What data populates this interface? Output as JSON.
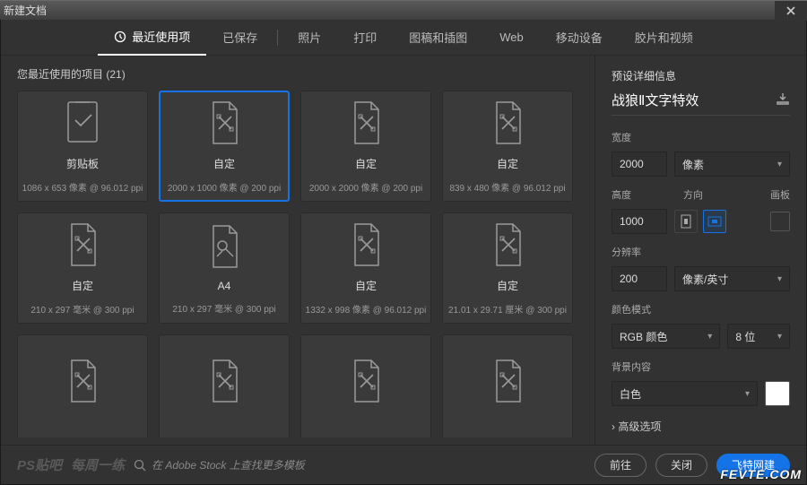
{
  "title": "新建文档",
  "tabs": [
    {
      "label": "最近使用项",
      "active": true
    },
    {
      "label": "已保存"
    },
    {
      "label": "照片"
    },
    {
      "label": "打印"
    },
    {
      "label": "图稿和插图"
    },
    {
      "label": "Web"
    },
    {
      "label": "移动设备"
    },
    {
      "label": "胶片和视频"
    }
  ],
  "recent_header_prefix": "您最近使用的项目",
  "recent_count": "(21)",
  "presets": [
    {
      "name": "剪贴板",
      "spec": "1086 x 653 像素 @ 96.012 ppi",
      "icon": "clipboard"
    },
    {
      "name": "自定",
      "spec": "2000 x 1000 像素 @ 200 ppi",
      "icon": "custom",
      "selected": true
    },
    {
      "name": "自定",
      "spec": "2000 x 2000 像素 @ 200 ppi",
      "icon": "custom"
    },
    {
      "name": "自定",
      "spec": "839 x 480 像素 @ 96.012 ppi",
      "icon": "custom"
    },
    {
      "name": "自定",
      "spec": "210 x 297 毫米 @ 300 ppi",
      "icon": "custom"
    },
    {
      "name": "A4",
      "spec": "210 x 297 毫米 @ 300 ppi",
      "icon": "a4"
    },
    {
      "name": "自定",
      "spec": "1332 x 998 像素 @ 96.012 ppi",
      "icon": "custom"
    },
    {
      "name": "自定",
      "spec": "21.01 x 29.71 厘米 @ 300 ppi",
      "icon": "custom"
    },
    {
      "name": "",
      "spec": "",
      "icon": "custom"
    },
    {
      "name": "",
      "spec": "",
      "icon": "custom"
    },
    {
      "name": "",
      "spec": "",
      "icon": "custom"
    },
    {
      "name": "",
      "spec": "",
      "icon": "custom"
    }
  ],
  "detail": {
    "section": "预设详细信息",
    "preset_name": "战狼Ⅱ文字特效",
    "width_label": "宽度",
    "width_value": "2000",
    "width_unit": "像素",
    "height_label": "高度",
    "height_value": "1000",
    "orient_label": "方向",
    "artboard_label": "画板",
    "resolution_label": "分辨率",
    "resolution_value": "200",
    "resolution_unit": "像素/英寸",
    "colormode_label": "颜色模式",
    "colormode_value": "RGB 颜色",
    "bitdepth": "8 位",
    "bg_label": "背景内容",
    "bg_value": "白色",
    "bg_swatch": "#ffffff",
    "advanced": "高级选项"
  },
  "footer": {
    "wm1": "PS贴吧",
    "wm2": "每周一练",
    "search_placeholder": "在 Adobe Stock 上查找更多模板",
    "go": "前往",
    "close": "关闭",
    "create": "飞特网建"
  },
  "brand": "FEVTE.COM"
}
